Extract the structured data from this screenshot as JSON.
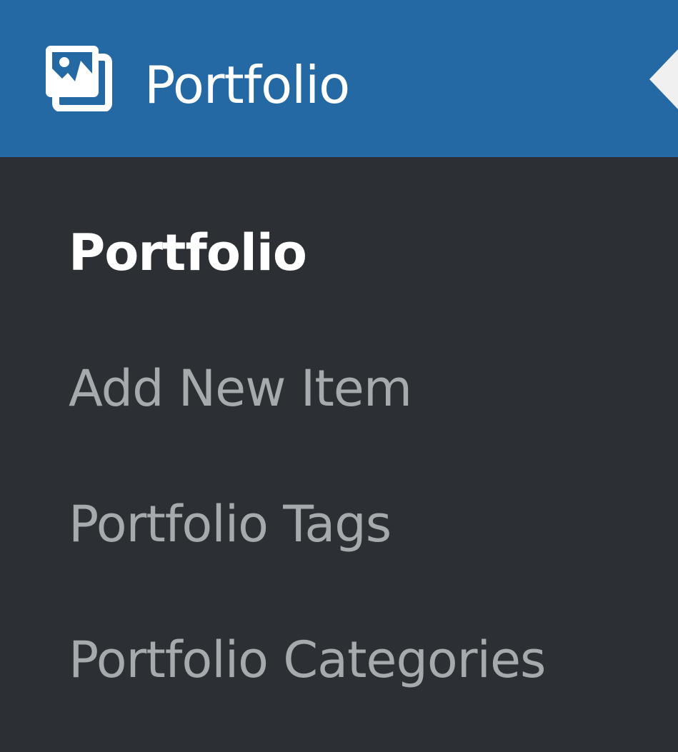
{
  "menu": {
    "icon": "portfolio-images-icon",
    "title": "Portfolio",
    "submenu": [
      {
        "label": "Portfolio",
        "current": true
      },
      {
        "label": "Add New Item",
        "current": false
      },
      {
        "label": "Portfolio Tags",
        "current": false
      },
      {
        "label": "Portfolio Categories",
        "current": false
      }
    ]
  },
  "colors": {
    "header_bg": "#2469a3",
    "menu_bg": "#2c3035",
    "text_current": "#ffffff",
    "text_muted": "#a7aaad"
  }
}
